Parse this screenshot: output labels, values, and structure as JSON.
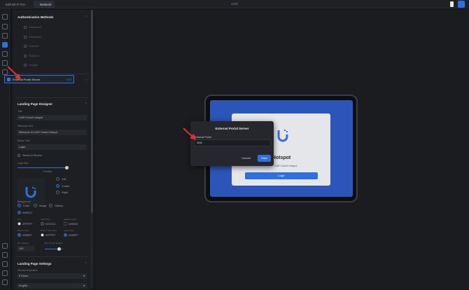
{
  "window": {
    "tab1": "Edit Wi-Fi Pro",
    "tab2": "Network",
    "title": "UniFi"
  },
  "auth_methods": {
    "title": "Authentication Methods",
    "items": [
      "Password",
      "Facebook",
      "Voucher",
      "RADIUS",
      "Google"
    ]
  },
  "one_way": {
    "title": "One-Way Methods",
    "item": "External Portal Server",
    "edit": "Edit"
  },
  "landing": {
    "title": "Landing Page Designer",
    "title_label": "Title",
    "title_value": "UniFi Guest Hotspot",
    "welcome_label": "Welcome Text",
    "welcome_value": "Welcome to UniFi Guest Hotspot",
    "button_label": "Button Text",
    "button_value": "Login",
    "terms": "Terms of Service",
    "logo_size": "Logo Size",
    "position_label": "Position",
    "positions": [
      "Left",
      "Center",
      "Right"
    ],
    "background_label": "Background",
    "bg_options": [
      "Color",
      "Image",
      "Gallery"
    ],
    "bg_color": "#0052CC",
    "colors": [
      {
        "label": "Text",
        "value": "#FFFFFF"
      },
      {
        "label": "Link Color",
        "value": "#2C2C2C"
      },
      {
        "label": "Header Color",
        "value": "#000000"
      },
      {
        "label": "Button Color",
        "value": "#0059FF"
      },
      {
        "label": "Button Text Color",
        "value": "#FFFFFF"
      },
      {
        "label": "Logo Color",
        "value": "#0059FF"
      }
    ],
    "box_opacity_label": "Box Opacity",
    "box_opacity_value": "100",
    "bg_blur_label": "Box Corner Radius"
  },
  "settings": {
    "title": "Landing Page Settings",
    "label": "Session Expiration",
    "value": "8 Hours",
    "language": "English"
  },
  "preview": {
    "title": "Guest Hotspot",
    "subtitle": "UniFi Guest Hotspot",
    "button": "Login"
  },
  "modal": {
    "title": "External Portal Server",
    "label": "External Portal",
    "value": "1111",
    "cancel": "Cancel",
    "save": "Save"
  },
  "colors": {
    "accent": "#2f6fe0",
    "arrow": "#e5322b",
    "preview_bg": "#2b55b8"
  }
}
